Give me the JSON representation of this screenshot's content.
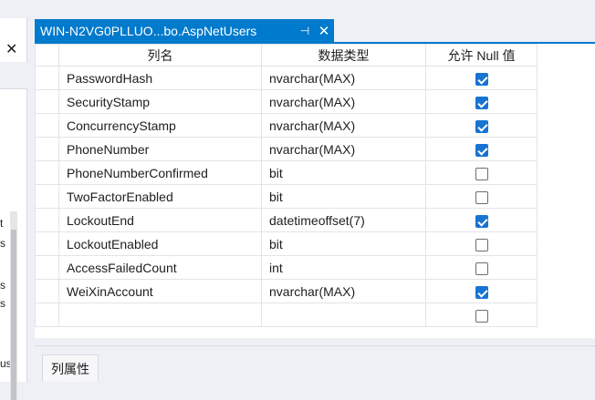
{
  "tab": {
    "title": "WIN-N2VG0PLLUO...bo.AspNetUsers",
    "pin_glyph": "⊣",
    "close_glyph": "✕"
  },
  "left_panel": {
    "close_glyph": "✕",
    "fragments": [
      "t",
      "s",
      "s",
      "s",
      "us"
    ]
  },
  "columns": [
    "列名",
    "数据类型",
    "允许 Null 值"
  ],
  "rows": [
    {
      "name": "PasswordHash",
      "type": "nvarchar(MAX)",
      "nullable": true
    },
    {
      "name": "SecurityStamp",
      "type": "nvarchar(MAX)",
      "nullable": true
    },
    {
      "name": "ConcurrencyStamp",
      "type": "nvarchar(MAX)",
      "nullable": true
    },
    {
      "name": "PhoneNumber",
      "type": "nvarchar(MAX)",
      "nullable": true
    },
    {
      "name": "PhoneNumberConfirmed",
      "type": "bit",
      "nullable": false
    },
    {
      "name": "TwoFactorEnabled",
      "type": "bit",
      "nullable": false
    },
    {
      "name": "LockoutEnd",
      "type": "datetimeoffset(7)",
      "nullable": true
    },
    {
      "name": "LockoutEnabled",
      "type": "bit",
      "nullable": false
    },
    {
      "name": "AccessFailedCount",
      "type": "int",
      "nullable": false
    },
    {
      "name": "WeiXinAccount",
      "type": "nvarchar(MAX)",
      "nullable": true
    },
    {
      "name": "",
      "type": "",
      "nullable": false
    }
  ],
  "properties_tab": "列属性",
  "colors": {
    "accent": "#007acc",
    "checkbox_checked": "#1874d2"
  }
}
